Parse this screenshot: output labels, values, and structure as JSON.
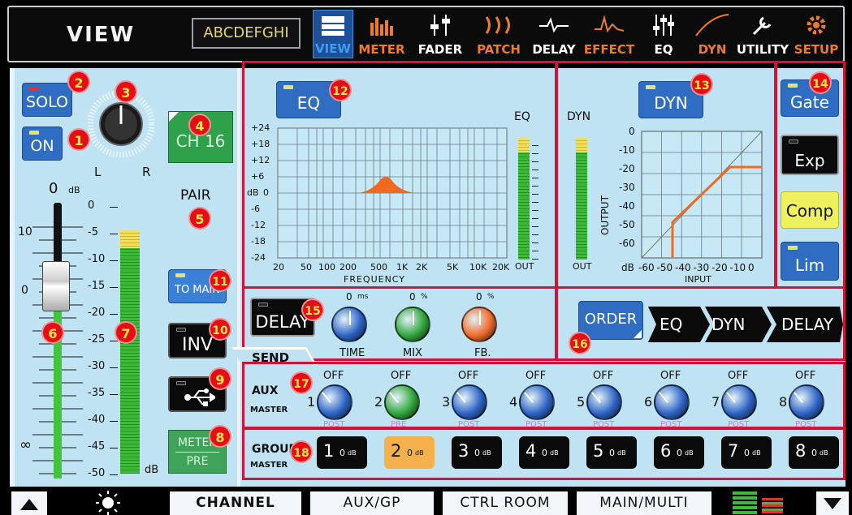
{
  "header": {
    "title": "VIEW",
    "channel_name": "ABCDEFGHI",
    "tabs": [
      {
        "label": "VIEW",
        "color": "#3b8ee0"
      },
      {
        "label": "METER",
        "color": "#ef7b27"
      },
      {
        "label": "FADER",
        "color": "#ffffff"
      },
      {
        "label": "PATCH",
        "color": "#ef7b27"
      },
      {
        "label": "DELAY",
        "color": "#ffffff"
      },
      {
        "label": "EFFECT",
        "color": "#ef7b27"
      },
      {
        "label": "EQ",
        "color": "#ffffff"
      },
      {
        "label": "DYN",
        "color": "#ef7b27"
      },
      {
        "label": "UTILITY",
        "color": "#ffffff"
      },
      {
        "label": "SETUP",
        "color": "#ef7b27"
      }
    ]
  },
  "left": {
    "solo": "SOLO",
    "on": "ON",
    "pan_l": "L",
    "pan_r": "R",
    "channel": "CH 16",
    "pair": "PAIR",
    "to_main": "TO MAIN",
    "inv": "INV",
    "meter_pre": [
      "METER",
      "PRE"
    ],
    "fader_top": "0",
    "fader_top_unit": "dB",
    "fader_scale": [
      "10",
      "0",
      "∞"
    ],
    "meter_scale": [
      "0",
      "-5",
      "-10",
      "-15",
      "-20",
      "-25",
      "-30",
      "-35",
      "-40",
      "-45",
      "-50"
    ],
    "meter_unit": "dB"
  },
  "eq": {
    "button": "EQ",
    "y_scale": [
      "+24",
      "+18",
      "+12",
      "+6",
      "0",
      "-6",
      "-12",
      "-18",
      "-24"
    ],
    "y_unit": "dB",
    "x_scale": [
      "20",
      "50",
      "100",
      "200",
      "500",
      "1K",
      "2K",
      "5K",
      "10K",
      "20K"
    ],
    "x_label": "FREQUENCY",
    "meter_label": "EQ",
    "meter_out": "OUT",
    "meter_unit": "dB"
  },
  "dyn": {
    "button": "DYN",
    "meter_label": "DYN",
    "meter_out": "OUT",
    "y_scale": [
      "0",
      "-10",
      "-20",
      "-30",
      "-40",
      "-50",
      "-60"
    ],
    "y_label": "OUTPUT",
    "x_scale": [
      "-60",
      "-50",
      "-40",
      "-30",
      "-20",
      "-10",
      "0"
    ],
    "x_label": "INPUT",
    "x_unit": "dB"
  },
  "dyn_types": [
    "Gate",
    "Exp",
    "Comp",
    "Lim"
  ],
  "delay": {
    "button": "DELAY",
    "knobs": [
      {
        "value": "0",
        "unit": "ms",
        "label": "TIME",
        "color": "#2c62c4"
      },
      {
        "value": "0",
        "unit": "%",
        "label": "MIX",
        "color": "#2fa53a"
      },
      {
        "value": "0",
        "unit": "%",
        "label": "FB.",
        "color": "#ef6a2a"
      }
    ]
  },
  "order": {
    "button": "ORDER",
    "chain": [
      "EQ",
      "DYN",
      "DELAY"
    ]
  },
  "send": {
    "tab": "SEND",
    "aux_label": "AUX",
    "aux_sub": "MASTER",
    "aux": [
      {
        "n": "1",
        "val": "OFF",
        "mode": "POST"
      },
      {
        "n": "2",
        "val": "OFF",
        "mode": "PRE"
      },
      {
        "n": "3",
        "val": "OFF",
        "mode": "POST"
      },
      {
        "n": "4",
        "val": "OFF",
        "mode": "POST"
      },
      {
        "n": "5",
        "val": "OFF",
        "mode": "POST"
      },
      {
        "n": "6",
        "val": "OFF",
        "mode": "POST"
      },
      {
        "n": "7",
        "val": "OFF",
        "mode": "POST"
      },
      {
        "n": "8",
        "val": "OFF",
        "mode": "POST"
      }
    ],
    "group_label": "GROUP",
    "group_sub": "MASTER",
    "groups": [
      {
        "n": "1",
        "val": "0",
        "unit": "dB"
      },
      {
        "n": "2",
        "val": "0",
        "unit": "dB"
      },
      {
        "n": "3",
        "val": "0",
        "unit": "dB"
      },
      {
        "n": "4",
        "val": "0",
        "unit": "dB"
      },
      {
        "n": "5",
        "val": "0",
        "unit": "dB"
      },
      {
        "n": "6",
        "val": "0",
        "unit": "dB"
      },
      {
        "n": "7",
        "val": "0",
        "unit": "dB"
      },
      {
        "n": "8",
        "val": "0",
        "unit": "dB"
      }
    ]
  },
  "badges": [
    "1",
    "2",
    "3",
    "4",
    "5",
    "6",
    "7",
    "8",
    "9",
    "10",
    "11",
    "12",
    "13",
    "14",
    "15",
    "16",
    "17",
    "18"
  ],
  "footer": {
    "tabs": [
      "CHANNEL",
      "AUX/GP",
      "CTRL ROOM",
      "MAIN/MULTI"
    ]
  }
}
